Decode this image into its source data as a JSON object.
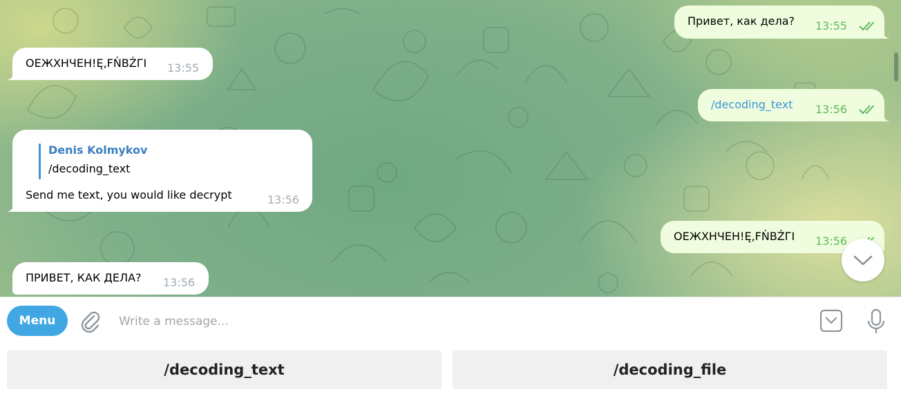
{
  "messages": [
    {
      "direction": "out",
      "text": "Привет, как дела?",
      "time": "13:55"
    },
    {
      "direction": "in",
      "text": "ОЕЖХНЧЕН!Ę,FŃBŹГI",
      "time": "13:55"
    },
    {
      "direction": "out",
      "text": "/decoding_text",
      "time": "13:56"
    },
    {
      "direction": "in",
      "reply": {
        "name": "Denis Kolmykov",
        "text": "/decoding_text"
      },
      "text": "Send me text, you would like decrypt",
      "time": "13:56"
    },
    {
      "direction": "out",
      "text": "ОЕЖХНЧЕН!Ę,FŃBŹГI",
      "time": "13:56"
    },
    {
      "direction": "in",
      "text": "ПРИВЕТ, КАК ДЕЛА?",
      "time": "13:56"
    }
  ],
  "input": {
    "menu_label": "Menu",
    "placeholder": "Write a message..."
  },
  "keyboard": {
    "buttons": [
      "/decoding_text",
      "/decoding_file"
    ]
  },
  "icons": {
    "attach": "paperclip-icon",
    "keyboard": "bot-keyboard-icon",
    "mic": "microphone-icon",
    "scroll": "chevron-down-icon",
    "read": "double-check-icon"
  },
  "colors": {
    "accent": "#40a7e3",
    "outgoing_bubble": "#effdde",
    "incoming_bubble": "#ffffff",
    "outgoing_time": "#5fb857",
    "link": "#3a95d5"
  }
}
